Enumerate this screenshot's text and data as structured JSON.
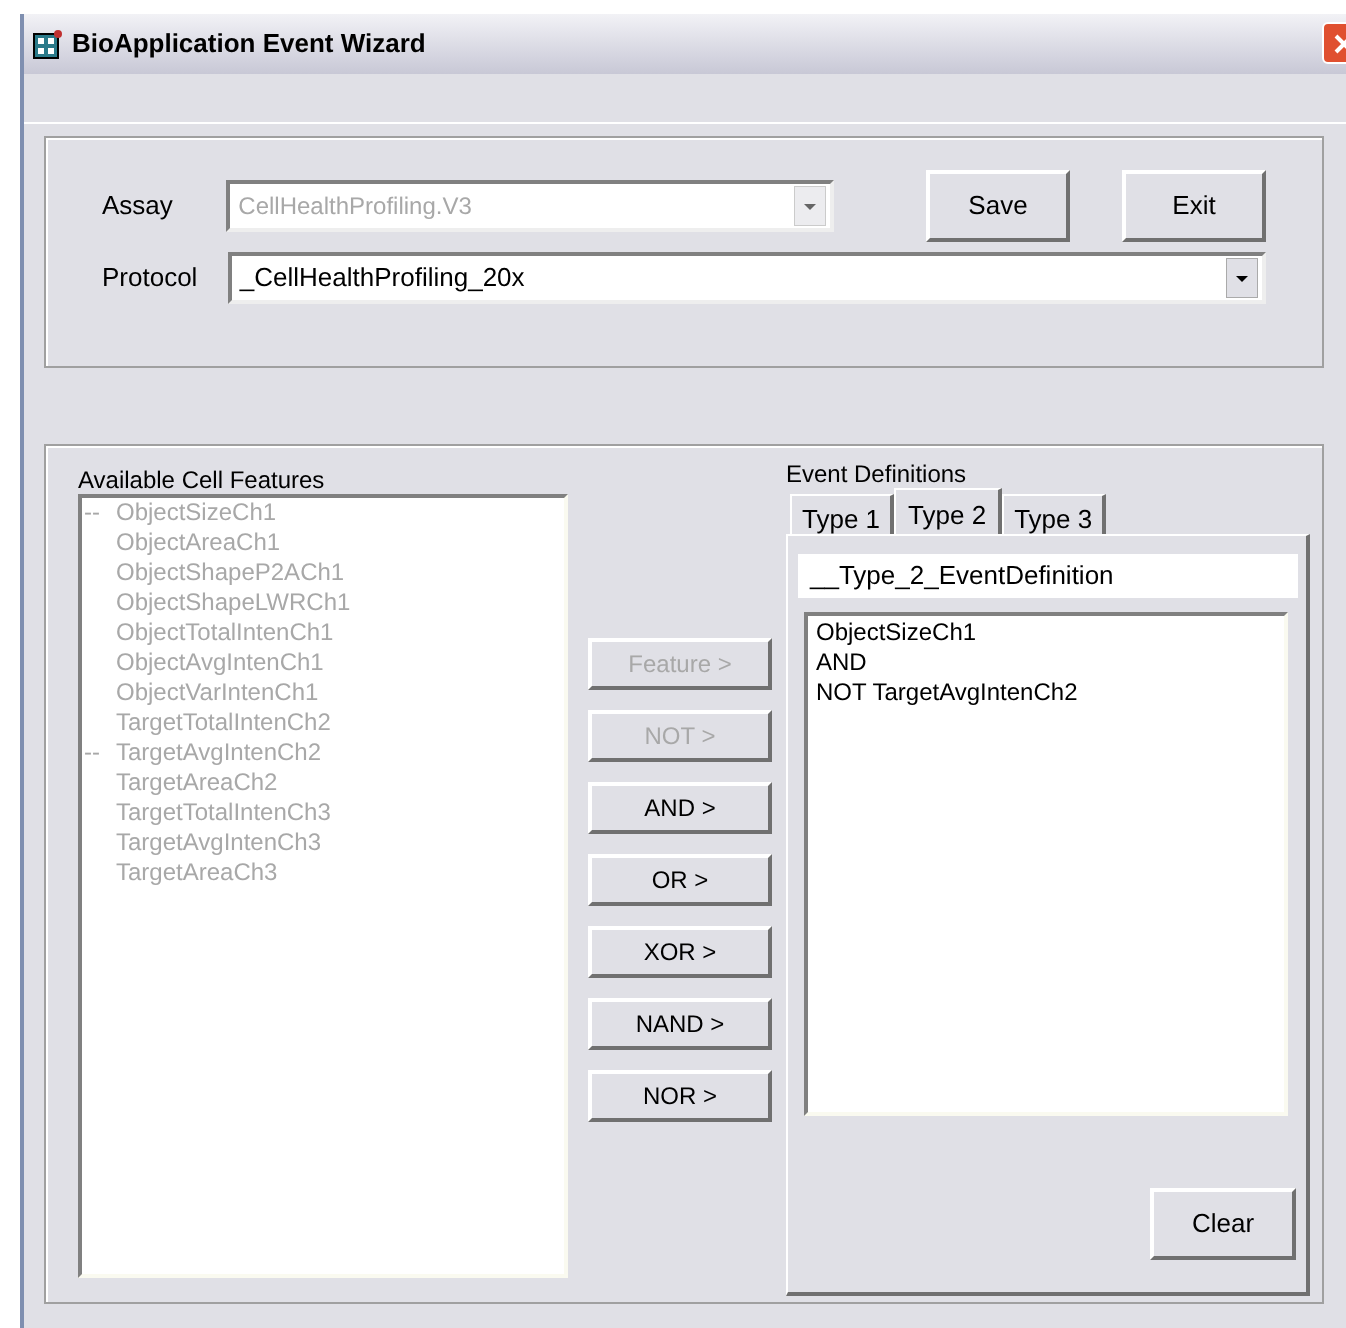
{
  "window": {
    "title": "BioApplication Event Wizard"
  },
  "assay": {
    "label": "Assay",
    "value": "CellHealthProfiling.V3",
    "disabled": true
  },
  "protocol": {
    "label": "Protocol",
    "value": "_CellHealthProfiling_20x",
    "disabled": false
  },
  "top_buttons": [
    {
      "label": "Save",
      "disabled": false
    },
    {
      "label": "Exit",
      "disabled": false
    }
  ],
  "features": {
    "label": "Available Cell Features",
    "disabled": true,
    "items": [
      {
        "prefix": "--",
        "label": "ObjectSizeCh1"
      },
      {
        "label": "ObjectAreaCh1"
      },
      {
        "label": "ObjectShapeP2ACh1"
      },
      {
        "label": "ObjectShapeLWRCh1"
      },
      {
        "label": "ObjectTotalIntenCh1"
      },
      {
        "label": "ObjectAvgIntenCh1"
      },
      {
        "label": "ObjectVarIntenCh1"
      },
      {
        "label": "TargetTotalIntenCh2"
      },
      {
        "prefix": "--",
        "label": "TargetAvgIntenCh2"
      },
      {
        "label": "TargetAreaCh2"
      },
      {
        "label": "TargetTotalIntenCh3"
      },
      {
        "label": "TargetAvgIntenCh3"
      },
      {
        "label": "TargetAreaCh3"
      }
    ]
  },
  "operators": [
    {
      "label": "Feature >",
      "disabled": true
    },
    {
      "label": "NOT >",
      "disabled": true
    },
    {
      "label": "AND >",
      "disabled": false
    },
    {
      "label": "OR >",
      "disabled": false
    },
    {
      "label": "XOR >",
      "disabled": false
    },
    {
      "label": "NAND >",
      "disabled": false
    },
    {
      "label": "NOR >",
      "disabled": false
    }
  ],
  "event_definitions": {
    "label": "Event Definitions",
    "tabs": [
      {
        "label": "Type 1",
        "selected": false
      },
      {
        "label": "Type 2",
        "selected": true
      },
      {
        "label": "Type 3",
        "selected": false
      }
    ],
    "name": "__Type_2_EventDefinition",
    "lines": [
      "ObjectSizeCh1",
      "AND",
      "NOT TargetAvgIntenCh2"
    ],
    "clear_button": "Clear"
  }
}
